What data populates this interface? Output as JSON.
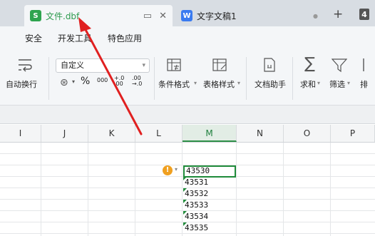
{
  "tabs": {
    "active": {
      "logo": "S",
      "title": "文件.dbf"
    },
    "inactive": {
      "logo": "W",
      "title": "文字文稿1"
    },
    "new_tab": "+",
    "window_count": "4"
  },
  "menu": [
    "安全",
    "开发工具",
    "特色应用"
  ],
  "ribbon": {
    "wrap_label": "自动换行",
    "number_format": "自定义",
    "percent_symbol": "%",
    "thousands_symbol": "000",
    "increase_decimal": "+.0\n.00",
    "decrease_decimal": ".00\n→.0",
    "conditional_format": "条件格式",
    "table_style": "表格样式",
    "doc_helper": "文档助手",
    "sum": "求和",
    "filter": "筛选",
    "truncated": "排"
  },
  "columns": [
    "I",
    "J",
    "K",
    "L",
    "M",
    "N",
    "O",
    "P"
  ],
  "selected_column": "M",
  "cells": [
    "43530",
    "43531",
    "43532",
    "43533",
    "43534",
    "43535"
  ],
  "colors": {
    "accent_green": "#1f8b3a",
    "annotation_red": "#e02020"
  }
}
